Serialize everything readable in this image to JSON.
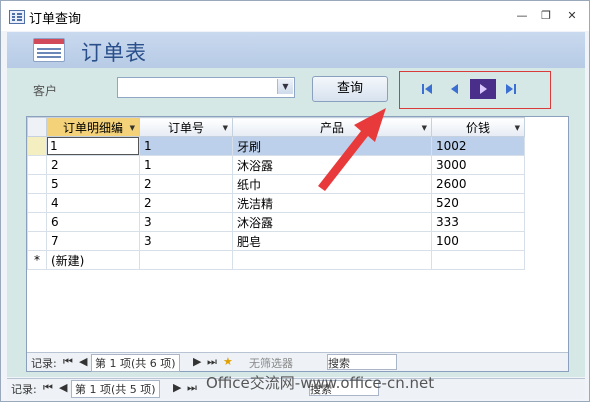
{
  "window": {
    "title": "订单查询"
  },
  "header": {
    "form_title": "订单表"
  },
  "filter": {
    "customer_label": "客户",
    "customer_value": "",
    "query_button": "查询"
  },
  "nav_buttons": [
    {
      "name": "first-record-icon"
    },
    {
      "name": "previous-record-icon"
    },
    {
      "name": "next-record-icon"
    },
    {
      "name": "last-record-icon"
    }
  ],
  "table": {
    "columns": [
      "订单明细编",
      "订单号",
      "产品",
      "价钱"
    ],
    "rows": [
      [
        "1",
        "1",
        "牙刷",
        "1002"
      ],
      [
        "2",
        "1",
        "沐浴露",
        "3000"
      ],
      [
        "5",
        "2",
        "纸巾",
        "2600"
      ],
      [
        "4",
        "2",
        "洗洁精",
        "520"
      ],
      [
        "6",
        "3",
        "沐浴露",
        "333"
      ],
      [
        "7",
        "3",
        "肥皂",
        "100"
      ]
    ],
    "new_row_marker": "*",
    "new_row_label": "(新建)"
  },
  "sub_record_bar": {
    "label": "记录:",
    "position": "第 1 项(共 6 项)",
    "filter": "无筛选器",
    "search": "搜索"
  },
  "main_record_bar": {
    "label": "记录:",
    "position": "第 1 项(共 5 项)",
    "search": "搜索"
  },
  "watermark": "Office交流网-www.office-cn.net",
  "colors": {
    "highlight": "#f4d27a",
    "selected_row": "#bcd0ec",
    "annotation": "#d93a3a",
    "header": "#c9d9ee"
  }
}
